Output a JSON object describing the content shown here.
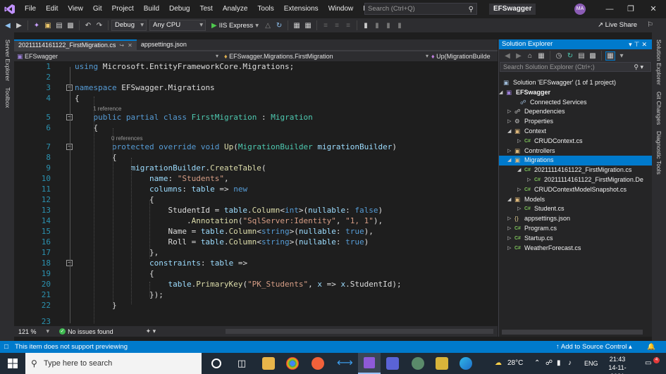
{
  "menubar": {
    "items": [
      "File",
      "Edit",
      "View",
      "Git",
      "Project",
      "Build",
      "Debug",
      "Test",
      "Analyze",
      "Tools",
      "Extensions",
      "Window",
      "Help"
    ],
    "search_placeholder": "Search (Ctrl+Q)",
    "solution_name": "EFSwagger",
    "avatar_initials": "MA"
  },
  "toolbar": {
    "config": "Debug",
    "platform": "Any CPU",
    "run_target": "IIS Express",
    "live_share": "Live Share"
  },
  "side_panels": {
    "left": [
      "Server Explorer",
      "Toolbox"
    ],
    "right": [
      "Solution Explorer",
      "Git Changes",
      "Diagnostic Tools"
    ]
  },
  "tabs": [
    {
      "label": "20211114161122_FirstMigration.cs",
      "active": true
    },
    {
      "label": "appsettings.json",
      "active": false
    }
  ],
  "navbar": {
    "project": "EFSwagger",
    "type": "EFSwagger.Migrations.FirstMigration",
    "member": "Up(MigrationBuilde"
  },
  "editor": {
    "zoom": "121 %",
    "issues": "No issues found",
    "references": {
      "class": "1 reference",
      "method": "0 references"
    },
    "lines": [
      {
        "n": "1",
        "tokens": [
          [
            "kw",
            "using"
          ],
          [
            "tx",
            " Microsoft.EntityFrameworkCore.Migrations;"
          ]
        ]
      },
      {
        "n": "2",
        "tokens": []
      },
      {
        "n": "3",
        "tokens": [
          [
            "kw",
            "namespace"
          ],
          [
            "tx",
            " EFSwagger.Migrations"
          ]
        ]
      },
      {
        "n": "4",
        "tokens": [
          [
            "tx",
            "{"
          ]
        ]
      },
      {
        "n": "5",
        "tokens": [
          [
            "tx",
            "    "
          ],
          [
            "kw",
            "public"
          ],
          [
            "tx",
            " "
          ],
          [
            "kw",
            "partial"
          ],
          [
            "tx",
            " "
          ],
          [
            "kw",
            "class"
          ],
          [
            "tx",
            " "
          ],
          [
            "ty",
            "FirstMigration"
          ],
          [
            "tx",
            " : "
          ],
          [
            "ty",
            "Migration"
          ]
        ]
      },
      {
        "n": "6",
        "tokens": [
          [
            "tx",
            "    {"
          ]
        ]
      },
      {
        "n": "7",
        "tokens": [
          [
            "tx",
            "        "
          ],
          [
            "kw",
            "protected"
          ],
          [
            "tx",
            " "
          ],
          [
            "kw",
            "override"
          ],
          [
            "tx",
            " "
          ],
          [
            "kw",
            "void"
          ],
          [
            "tx",
            " "
          ],
          [
            "fn",
            "Up"
          ],
          [
            "tx",
            "("
          ],
          [
            "ty",
            "MigrationBuilder"
          ],
          [
            "tx",
            " "
          ],
          [
            "pr",
            "migrationBuilder"
          ],
          [
            "tx",
            ")"
          ]
        ]
      },
      {
        "n": "8",
        "tokens": [
          [
            "tx",
            "        {"
          ]
        ]
      },
      {
        "n": "9",
        "tokens": [
          [
            "tx",
            "            "
          ],
          [
            "pr",
            "migrationBuilder"
          ],
          [
            "tx",
            "."
          ],
          [
            "fn",
            "CreateTable"
          ],
          [
            "tx",
            "("
          ]
        ]
      },
      {
        "n": "10",
        "tokens": [
          [
            "tx",
            "                "
          ],
          [
            "pr",
            "name"
          ],
          [
            "tx",
            ": "
          ],
          [
            "st",
            "\"Students\""
          ],
          [
            "tx",
            ","
          ]
        ]
      },
      {
        "n": "11",
        "tokens": [
          [
            "tx",
            "                "
          ],
          [
            "pr",
            "columns"
          ],
          [
            "tx",
            ": "
          ],
          [
            "pr",
            "table"
          ],
          [
            "tx",
            " => "
          ],
          [
            "kw",
            "new"
          ]
        ]
      },
      {
        "n": "12",
        "tokens": [
          [
            "tx",
            "                {"
          ]
        ]
      },
      {
        "n": "13",
        "tokens": [
          [
            "tx",
            "                    StudentId = "
          ],
          [
            "pr",
            "table"
          ],
          [
            "tx",
            "."
          ],
          [
            "fn",
            "Column"
          ],
          [
            "tx",
            "<"
          ],
          [
            "kw",
            "int"
          ],
          [
            "tx",
            ">("
          ],
          [
            "pr",
            "nullable"
          ],
          [
            "tx",
            ": "
          ],
          [
            "kw",
            "false"
          ],
          [
            "tx",
            ")"
          ]
        ]
      },
      {
        "n": "14",
        "tokens": [
          [
            "tx",
            "                        ."
          ],
          [
            "fn",
            "Annotation"
          ],
          [
            "tx",
            "("
          ],
          [
            "st",
            "\"SqlServer:Identity\""
          ],
          [
            "tx",
            ", "
          ],
          [
            "st",
            "\"1, 1\""
          ],
          [
            "tx",
            "),"
          ]
        ]
      },
      {
        "n": "15",
        "tokens": [
          [
            "tx",
            "                    Name = "
          ],
          [
            "pr",
            "table"
          ],
          [
            "tx",
            "."
          ],
          [
            "fn",
            "Column"
          ],
          [
            "tx",
            "<"
          ],
          [
            "kw",
            "string"
          ],
          [
            "tx",
            ">("
          ],
          [
            "pr",
            "nullable"
          ],
          [
            "tx",
            ": "
          ],
          [
            "kw",
            "true"
          ],
          [
            "tx",
            "),"
          ]
        ]
      },
      {
        "n": "16",
        "tokens": [
          [
            "tx",
            "                    Roll = "
          ],
          [
            "pr",
            "table"
          ],
          [
            "tx",
            "."
          ],
          [
            "fn",
            "Column"
          ],
          [
            "tx",
            "<"
          ],
          [
            "kw",
            "string"
          ],
          [
            "tx",
            ">("
          ],
          [
            "pr",
            "nullable"
          ],
          [
            "tx",
            ": "
          ],
          [
            "kw",
            "true"
          ],
          [
            "tx",
            ")"
          ]
        ]
      },
      {
        "n": "17",
        "tokens": [
          [
            "tx",
            "                },"
          ]
        ]
      },
      {
        "n": "18",
        "tokens": [
          [
            "tx",
            "                "
          ],
          [
            "pr",
            "constraints"
          ],
          [
            "tx",
            ": "
          ],
          [
            "pr",
            "table"
          ],
          [
            "tx",
            " =>"
          ]
        ]
      },
      {
        "n": "19",
        "tokens": [
          [
            "tx",
            "                {"
          ]
        ]
      },
      {
        "n": "20",
        "tokens": [
          [
            "tx",
            "                    "
          ],
          [
            "pr",
            "table"
          ],
          [
            "tx",
            "."
          ],
          [
            "fn",
            "PrimaryKey"
          ],
          [
            "tx",
            "("
          ],
          [
            "st",
            "\"PK_Students\""
          ],
          [
            "tx",
            ", "
          ],
          [
            "pr",
            "x"
          ],
          [
            "tx",
            " => "
          ],
          [
            "pr",
            "x"
          ],
          [
            "tx",
            ".StudentId);"
          ]
        ]
      },
      {
        "n": "21",
        "tokens": [
          [
            "tx",
            "                });"
          ]
        ]
      },
      {
        "n": "22",
        "tokens": [
          [
            "tx",
            "        }"
          ]
        ]
      },
      {
        "n": "23",
        "tokens": []
      }
    ]
  },
  "solution_explorer": {
    "title": "Solution Explorer",
    "search_placeholder": "Search Solution Explorer (Ctrl+;)",
    "items": [
      {
        "label": "Solution 'EFSwagger' (1 of 1 project)",
        "icon": "solution-icon",
        "arrow": ""
      },
      {
        "label": "EFSwagger",
        "icon": "csproj-icon",
        "arrow": "expanded",
        "bold": true
      },
      {
        "label": "Connected Services",
        "icon": "connected-services-icon",
        "arrow": ""
      },
      {
        "label": "Dependencies",
        "icon": "dependencies-icon",
        "arrow": "collapsed"
      },
      {
        "label": "Properties",
        "icon": "properties-icon",
        "arrow": "collapsed"
      },
      {
        "label": "Context",
        "icon": "folder-icon",
        "arrow": "expanded"
      },
      {
        "label": "CRUDContext.cs",
        "icon": "csharp-file-icon",
        "arrow": "collapsed"
      },
      {
        "label": "Controllers",
        "icon": "folder-icon",
        "arrow": "collapsed"
      },
      {
        "label": "Migrations",
        "icon": "folder-icon",
        "arrow": "expanded",
        "selected": true
      },
      {
        "label": "20211114161122_FirstMigration.cs",
        "icon": "csharp-file-icon",
        "arrow": "expanded"
      },
      {
        "label": "20211114161122_FirstMigration.De",
        "icon": "csharp-file-icon",
        "arrow": "collapsed"
      },
      {
        "label": "CRUDContextModelSnapshot.cs",
        "icon": "csharp-file-icon",
        "arrow": "collapsed"
      },
      {
        "label": "Models",
        "icon": "folder-icon",
        "arrow": "expanded"
      },
      {
        "label": "Student.cs",
        "icon": "csharp-file-icon",
        "arrow": "collapsed"
      },
      {
        "label": "appsettings.json",
        "icon": "json-file-icon",
        "arrow": "collapsed"
      },
      {
        "label": "Program.cs",
        "icon": "csharp-file-icon",
        "arrow": "collapsed"
      },
      {
        "label": "Startup.cs",
        "icon": "csharp-file-icon",
        "arrow": "collapsed"
      },
      {
        "label": "WeatherForecast.cs",
        "icon": "csharp-file-icon",
        "arrow": "collapsed"
      }
    ]
  },
  "infobar": {
    "message": "This item does not support previewing",
    "source_control": "Add to Source Control"
  },
  "taskbar": {
    "search_placeholder": "Type here to search",
    "weather": "28°C",
    "language": "ENG",
    "time": "21:43",
    "date": "14-11-2021",
    "notification_count": "4"
  },
  "colors": {
    "accent": "#007acc",
    "keyword": "#569cd6",
    "type": "#4ec9b0",
    "method": "#dcdcaa",
    "string": "#d69d85",
    "param": "#9cdcfe",
    "line_number": "#2b91af"
  }
}
